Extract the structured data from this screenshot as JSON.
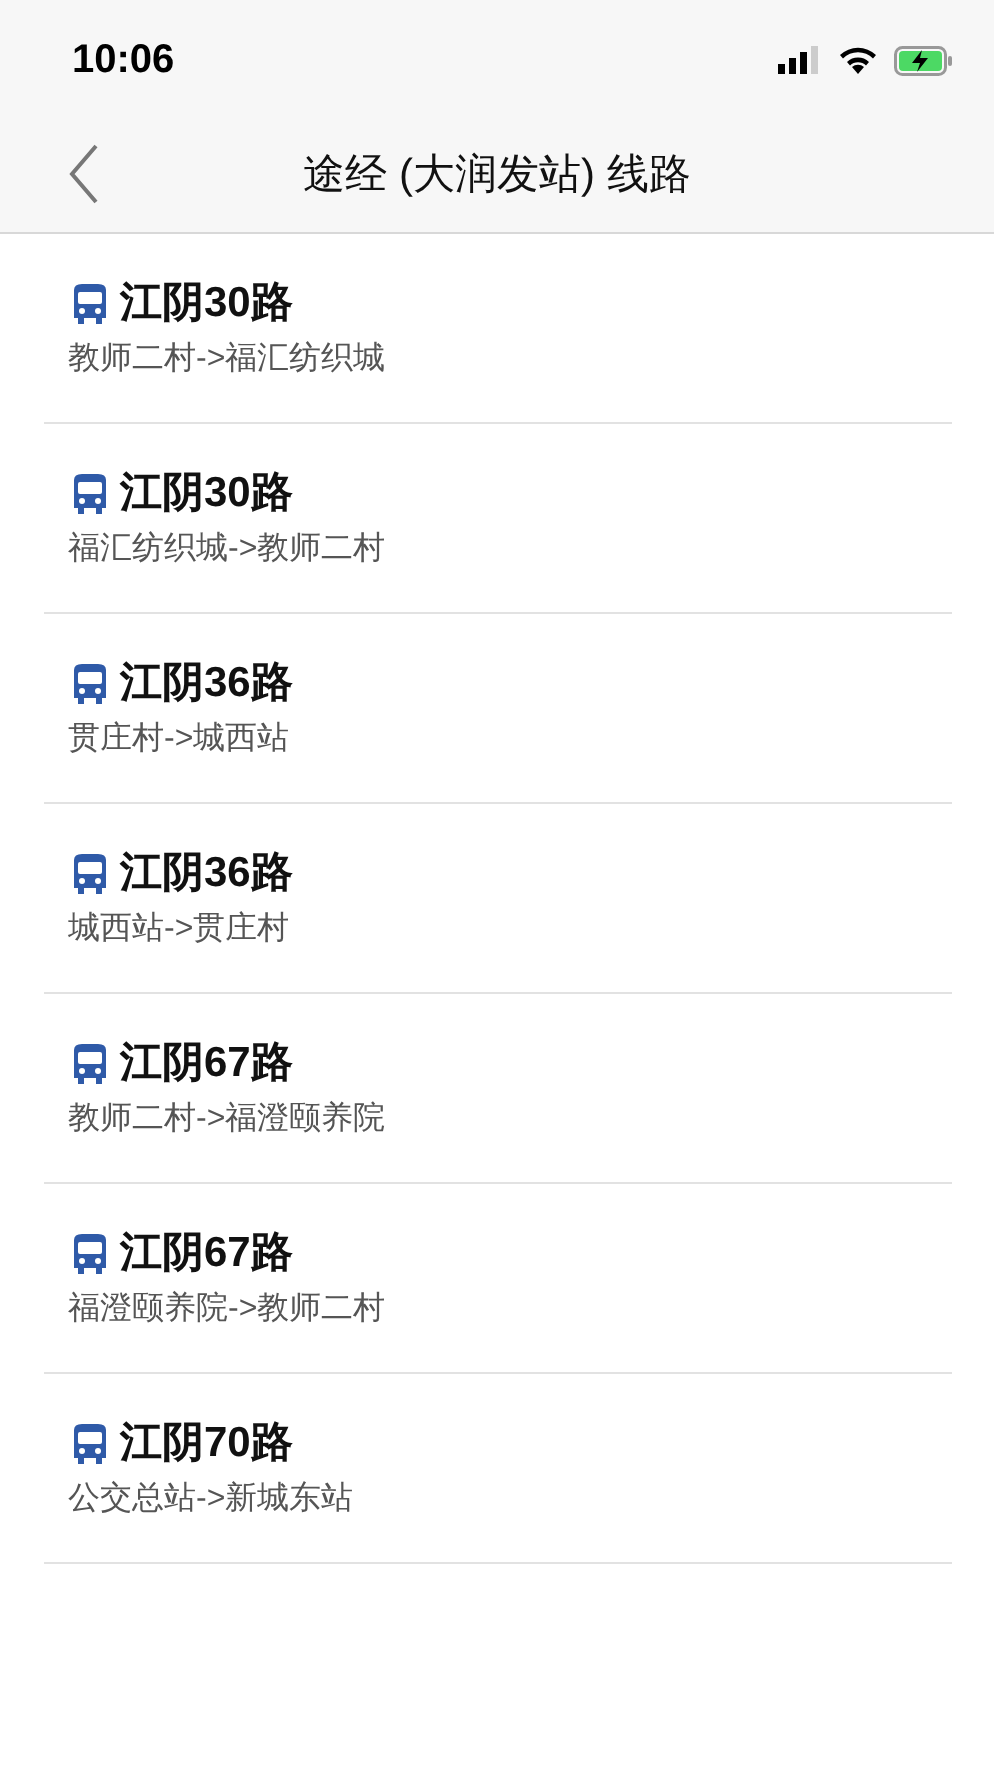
{
  "status_bar": {
    "time": "10:06"
  },
  "nav": {
    "title": "途经 (大润发站) 线路"
  },
  "routes": [
    {
      "name": "江阴30路",
      "direction": "教师二村->福汇纺织城"
    },
    {
      "name": "江阴30路",
      "direction": "福汇纺织城->教师二村"
    },
    {
      "name": "江阴36路",
      "direction": "贯庄村->城西站"
    },
    {
      "name": "江阴36路",
      "direction": "城西站->贯庄村"
    },
    {
      "name": "江阴67路",
      "direction": "教师二村->福澄颐养院"
    },
    {
      "name": "江阴67路",
      "direction": "福澄颐养院->教师二村"
    },
    {
      "name": "江阴70路",
      "direction": "公交总站->新城东站"
    }
  ]
}
